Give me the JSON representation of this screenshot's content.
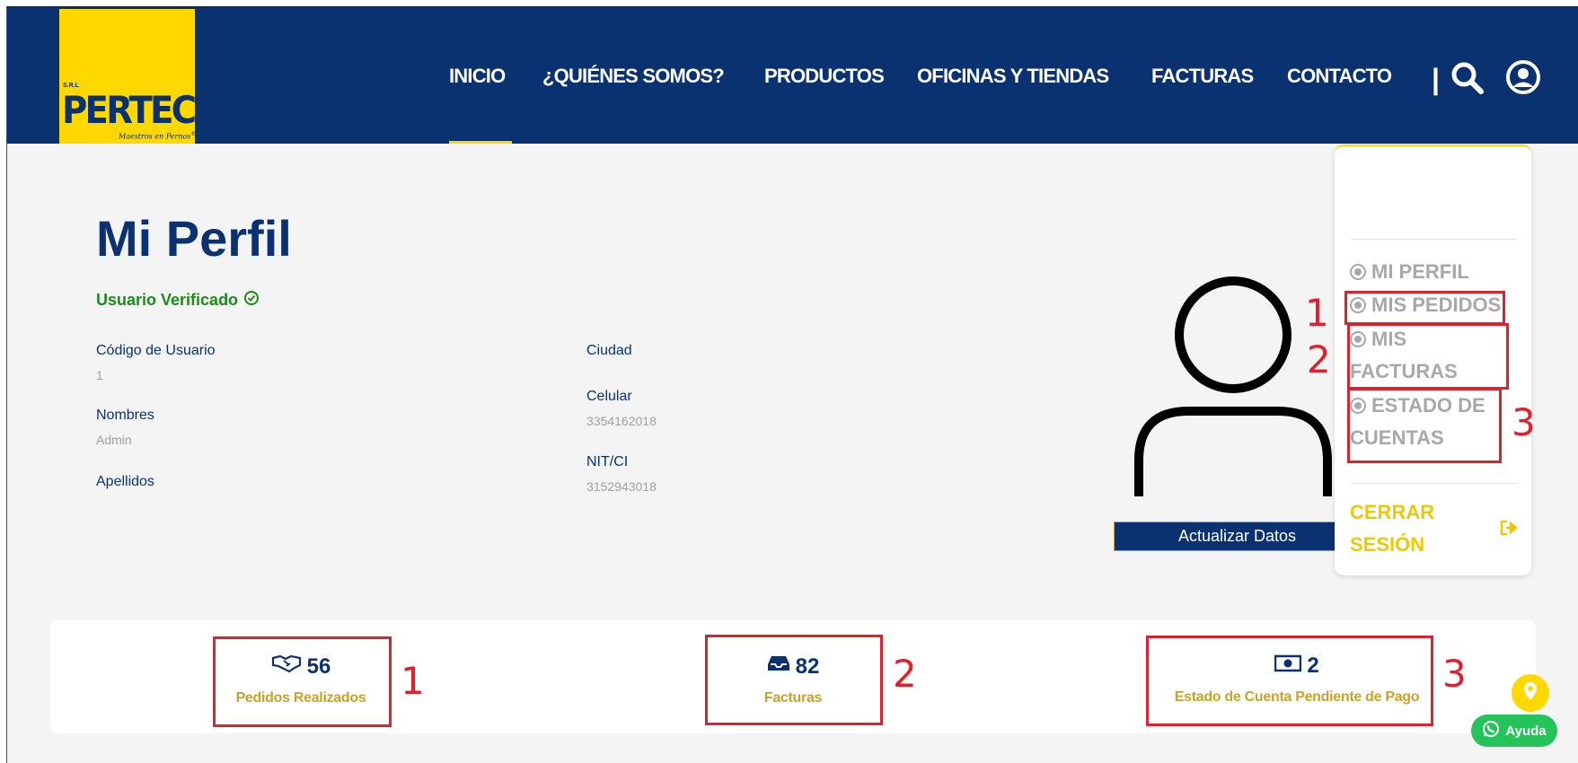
{
  "brand": {
    "srl": "S.R.L",
    "name": "PERTEC",
    "tagline": "Maestros en Pernos",
    "registered": "®",
    "primary_color": "#0a3170",
    "accent_color": "#ffd800"
  },
  "nav": {
    "items": [
      {
        "label": "INICIO",
        "active": true
      },
      {
        "label": "¿QUIÉNES SOMOS?"
      },
      {
        "label": "PRODUCTOS"
      },
      {
        "label": "OFICINAS Y TIENDAS"
      },
      {
        "label": "FACTURAS"
      },
      {
        "label": "CONTACTO"
      }
    ],
    "separator": "|",
    "icons": [
      "search-icon",
      "user-circle-icon"
    ]
  },
  "profile": {
    "title": "Mi Perfil",
    "verified_label": "Usuario Verificado",
    "fields": {
      "codigo": {
        "label": "Código de Usuario",
        "value": "1"
      },
      "nombres": {
        "label": "Nombres",
        "value": "Admin"
      },
      "apellidos": {
        "label": "Apellidos",
        "value": ""
      },
      "ciudad": {
        "label": "Ciudad",
        "value": ""
      },
      "celular": {
        "label": "Celular",
        "value": "3354162018"
      },
      "nit": {
        "label": "NIT/CI",
        "value": "3152943018"
      }
    },
    "update_button": "Actualizar Datos"
  },
  "menu": {
    "items": [
      {
        "label": "MI PERFIL"
      },
      {
        "label": "MIS PEDIDOS"
      },
      {
        "label_line1": "MIS",
        "label_line2": "FACTURAS"
      },
      {
        "label_line1": "ESTADO DE",
        "label_line2": "CUENTAS"
      }
    ],
    "logout_line1": "CERRAR",
    "logout_line2": "SESIÓN"
  },
  "stats": [
    {
      "icon": "handshake-icon",
      "value": "56",
      "label": "Pedidos Realizados"
    },
    {
      "icon": "inbox-icon",
      "value": "82",
      "label": "Facturas"
    },
    {
      "icon": "money-bill-icon",
      "value": "2",
      "label": "Estado de Cuenta Pendiente de Pago"
    }
  ],
  "annotations": {
    "menu": [
      "1",
      "2",
      "3"
    ],
    "stats": [
      "1",
      "2",
      "3"
    ]
  },
  "help_button": "Ayuda"
}
